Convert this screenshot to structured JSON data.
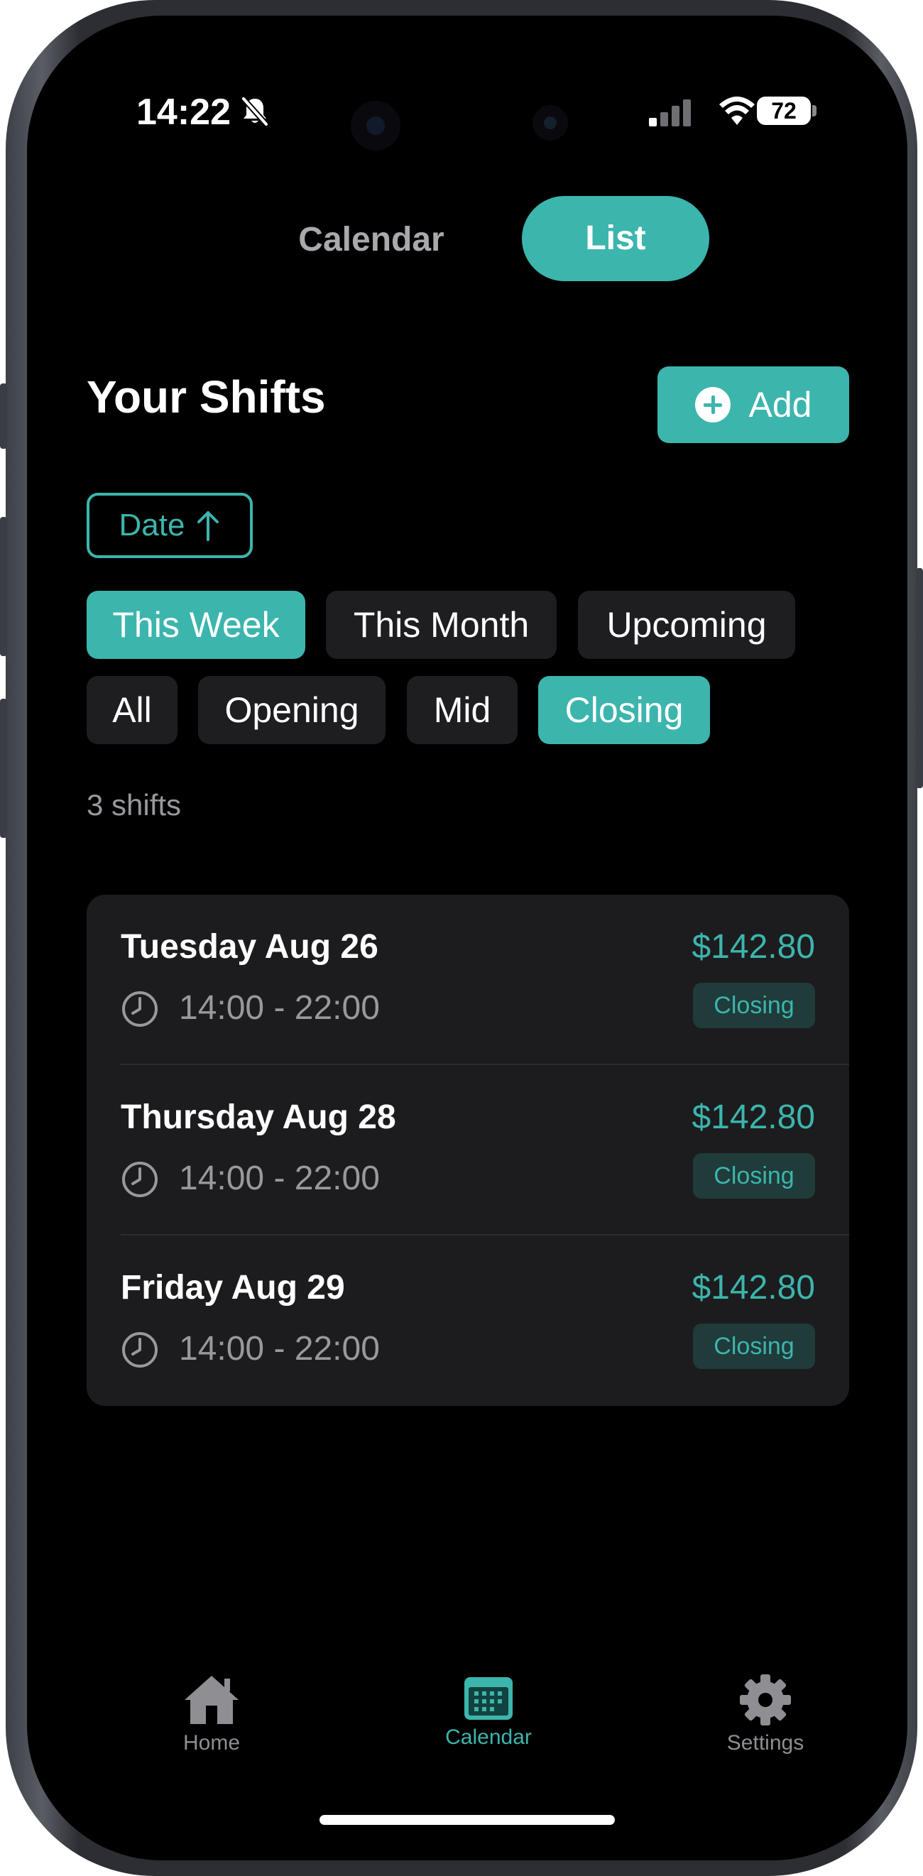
{
  "status_bar": {
    "time": "14:22",
    "battery": "72",
    "icons": [
      "bell-slash-icon",
      "cellular-signal-icon",
      "wifi-icon",
      "battery-icon"
    ]
  },
  "view_toggle": {
    "calendar_label": "Calendar",
    "list_label": "List",
    "selected": "List"
  },
  "header": {
    "title": "Your Shifts",
    "add_label": "Add",
    "add_icon": "plus-circle-icon"
  },
  "sort": {
    "label": "Date",
    "icon": "arrow-up-icon"
  },
  "filters": {
    "period": [
      {
        "label": "This Week",
        "active": true
      },
      {
        "label": "This Month",
        "active": false
      },
      {
        "label": "Upcoming",
        "active": false
      }
    ],
    "shift_type": [
      {
        "label": "All",
        "active": false
      },
      {
        "label": "Opening",
        "active": false
      },
      {
        "label": "Mid",
        "active": false
      },
      {
        "label": "Closing",
        "active": true
      }
    ]
  },
  "shift_count": "3 shifts",
  "shifts": [
    {
      "date": "Tuesday Aug 26",
      "time": "14:00 - 22:00",
      "pay": "$142.80",
      "type": "Closing"
    },
    {
      "date": "Thursday Aug 28",
      "time": "14:00 - 22:00",
      "pay": "$142.80",
      "type": "Closing"
    },
    {
      "date": "Friday Aug 29",
      "time": "14:00 - 22:00",
      "pay": "$142.80",
      "type": "Closing"
    }
  ],
  "tab_bar": {
    "items": [
      {
        "label": "Home",
        "icon": "house-icon",
        "active": false
      },
      {
        "label": "Calendar",
        "icon": "calendar-icon",
        "active": true
      },
      {
        "label": "Settings",
        "icon": "gear-icon",
        "active": false
      }
    ]
  },
  "colors": {
    "accent": "#3cb5ad",
    "background": "#000000",
    "card": "#1c1c1e",
    "chip": "#1e1e21",
    "muted_text": "#98989d",
    "badge_bg": "#1f3b3a"
  }
}
